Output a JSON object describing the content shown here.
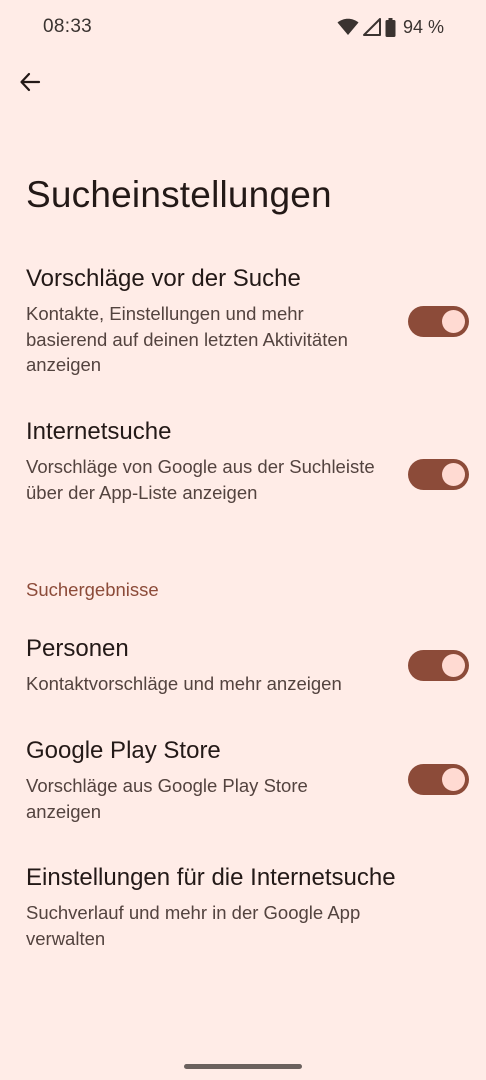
{
  "status_bar": {
    "time": "08:33",
    "battery": "94 %",
    "icons": [
      "wifi-icon",
      "cell-signal-icon",
      "battery-icon"
    ]
  },
  "header": {
    "back_icon": "arrow-back-icon",
    "title": "Sucheinstellungen"
  },
  "settings": [
    {
      "title": "Vorschläge vor der Suche",
      "description": "Kontakte, Einstellungen und mehr basierend auf deinen letzten Aktivitäten anzeigen",
      "enabled": true
    },
    {
      "title": "Internetsuche",
      "description": "Vorschläge von Google aus der Suchleiste über der App-Liste anzeigen",
      "enabled": true
    }
  ],
  "results_section": {
    "header": "Suchergebnisse",
    "items": [
      {
        "title": "Personen",
        "description": "Kontaktvorschläge und mehr anzeigen",
        "enabled": true
      },
      {
        "title": "Google Play Store",
        "description": "Vorschläge aus Google Play Store anzeigen",
        "enabled": true
      },
      {
        "title": "Einstellungen für die Internetsuche",
        "description": "Suchverlauf und mehr in der Google App verwalten"
      }
    ]
  },
  "colors": {
    "background": "#ffece7",
    "accent": "#8c4b39",
    "toggle_thumb": "#ffdad2",
    "text_primary": "#231917",
    "text_secondary": "#53433f"
  }
}
